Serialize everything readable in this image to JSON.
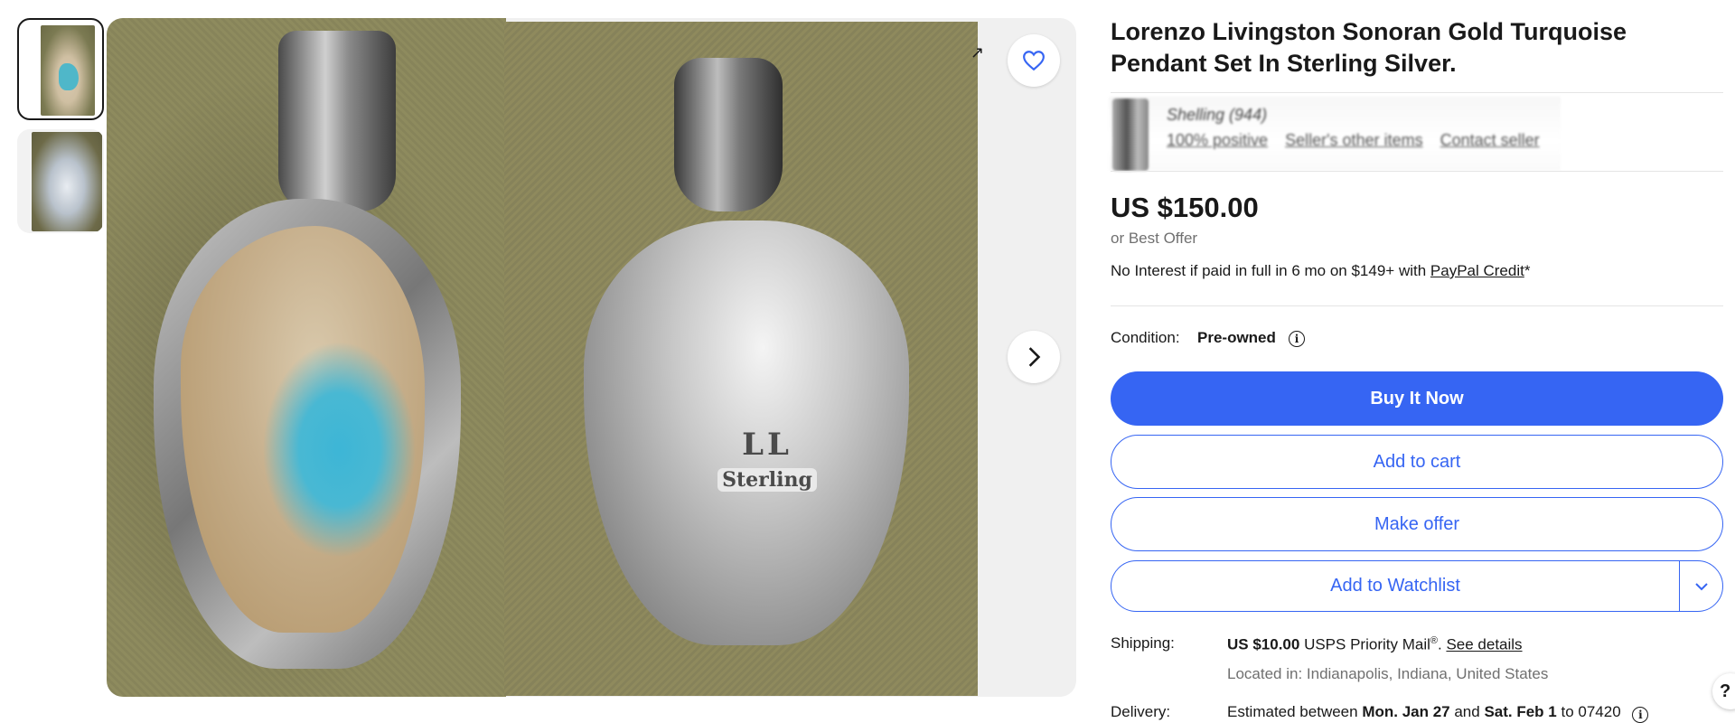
{
  "listing": {
    "title": "Lorenzo Livingston Sonoran Gold Turquoise Pendant Set In Sterling Silver.",
    "price": "US $150.00",
    "best_offer": "or Best Offer",
    "financing_prefix": "No Interest if paid in full in 6 mo on $149+ with ",
    "financing_link": "PayPal Credit",
    "financing_suffix": "*",
    "condition_label": "Condition:",
    "condition_value": "Pre-owned"
  },
  "seller": {
    "name_blurred": "Shelling (944)",
    "feedback_blurred": "100% positive",
    "other_items": "Seller's other items",
    "contact_blurred": "Contact seller"
  },
  "actions": {
    "buy_now": "Buy It Now",
    "add_to_cart": "Add to cart",
    "make_offer": "Make offer",
    "add_to_watchlist": "Add to Watchlist"
  },
  "shipping": {
    "label": "Shipping:",
    "price": "US $10.00",
    "service": " USPS Priority Mail",
    "reg_mark": "®",
    "period": ". ",
    "details_link": "See details",
    "location": "Located in: Indianapolis, Indiana, United States"
  },
  "delivery": {
    "label": "Delivery:",
    "prefix": "Estimated between ",
    "start": "Mon. Jan 27",
    "and": " and ",
    "end": "Sat. Feb 1",
    "suffix": " to 07420"
  },
  "gallery": {
    "stamp_initials": "LL",
    "stamp_word": "Sterling"
  },
  "icons": {
    "watch": "heart-icon",
    "next": "chevron-right-icon",
    "share": "share-icon",
    "info": "info-icon",
    "caret": "chevron-down-icon",
    "help": "help-icon"
  },
  "colors": {
    "accent": "#3665f3",
    "text": "#191919",
    "muted": "#707070"
  }
}
